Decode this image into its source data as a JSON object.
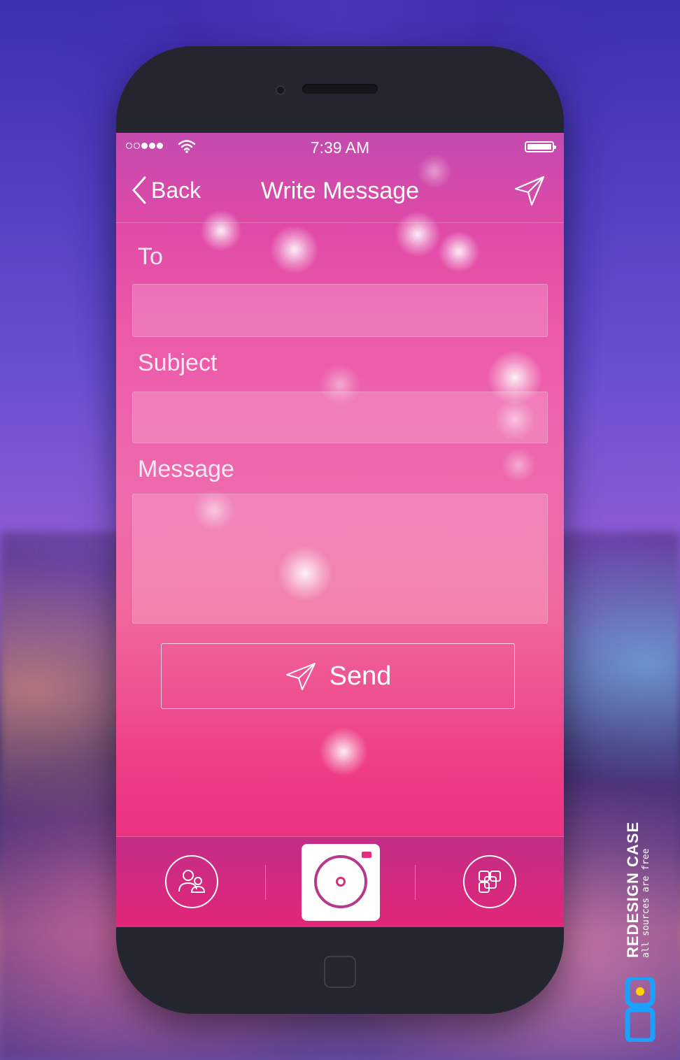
{
  "status_bar": {
    "time": "7:39 AM",
    "signal_bars_filled": 3,
    "signal_bars_total": 5,
    "wifi_icon": "wifi-icon",
    "battery_level": 1.0
  },
  "navbar": {
    "back_label": "Back",
    "title": "Write Message",
    "send_icon": "paper-plane-icon"
  },
  "form": {
    "to_label": "To",
    "to_value": "",
    "subject_label": "Subject",
    "subject_value": "",
    "message_label": "Message",
    "message_value": ""
  },
  "send_button": {
    "label": "Send",
    "icon": "paper-plane-icon"
  },
  "tabbar": {
    "left_icon": "contacts-icon",
    "center_icon": "camera-icon",
    "right_icon": "gallery-icon"
  },
  "watermark": {
    "title": "REDESIGN CASE",
    "subtitle": "all sources are free"
  },
  "colors": {
    "accent_pink": "#ee3d86",
    "accent_purple": "#b53a8a",
    "phone_body": "#23262e"
  }
}
